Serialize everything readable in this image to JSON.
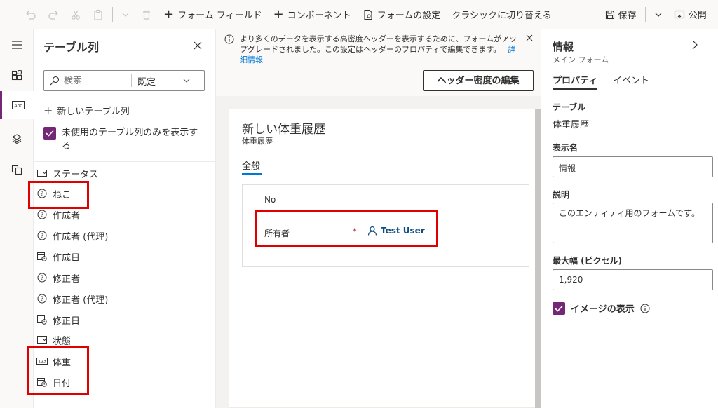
{
  "toolbar": {
    "undo_icon": "undo-icon",
    "redo_icon": "redo-icon",
    "cut_icon": "cut-icon",
    "paste_icon": "paste-icon",
    "delete_icon": "delete-icon",
    "form_field_label": "フォーム フィールド",
    "component_label": "コンポーネント",
    "form_settings_label": "フォームの設定",
    "classic_label": "クラシックに切り替える",
    "save_label": "保存",
    "publish_label": "公開"
  },
  "leftnav": {
    "items": [
      "hamburger-icon",
      "components-icon",
      "table-columns-icon",
      "layers-icon",
      "form-libraries-icon"
    ]
  },
  "field_pane": {
    "title": "テーブル列",
    "search_placeholder": "検索",
    "filter_value": "既定",
    "new_column_label": "新しいテーブル列",
    "show_unused_label": "未使用のテーブル列のみを表示する",
    "fields": [
      {
        "label": "ステータス",
        "icon": "option-set-icon"
      },
      {
        "label": "ねこ",
        "icon": "unknown-type-icon"
      },
      {
        "label": "作成者",
        "icon": "unknown-type-icon"
      },
      {
        "label": "作成者 (代理)",
        "icon": "unknown-type-icon"
      },
      {
        "label": "作成日",
        "icon": "date-time-icon"
      },
      {
        "label": "修正者",
        "icon": "unknown-type-icon"
      },
      {
        "label": "修正者 (代理)",
        "icon": "unknown-type-icon"
      },
      {
        "label": "修正日",
        "icon": "date-time-icon"
      },
      {
        "label": "状態",
        "icon": "option-set-icon"
      },
      {
        "label": "体重",
        "icon": "number-icon"
      },
      {
        "label": "日付",
        "icon": "date-time-icon"
      }
    ]
  },
  "canvas": {
    "notice_text": "より多くのデータを表示する高密度ヘッダーを表示するために、フォームがアップグレードされました。この設定はヘッダーのプロパティで編集できます。",
    "notice_link": "詳細情報",
    "header_density_button": "ヘッダー密度の編集",
    "form_title": "新しい体重履歴",
    "form_subtitle": "体重履歴",
    "tab_label": "全般",
    "rows": [
      {
        "label": "No",
        "value": "---"
      },
      {
        "label": "所有者",
        "required_mark": "*",
        "value": "Test User"
      }
    ]
  },
  "properties": {
    "title": "情報",
    "subtitle": "メイン フォーム",
    "tab_properties": "プロパティ",
    "tab_events": "イベント",
    "table_label": "テーブル",
    "table_value": "体重履歴",
    "display_name_label": "表示名",
    "display_name_value": "情報",
    "description_label": "説明",
    "description_value": "このエンティティ用のフォームです。",
    "max_width_label": "最大幅 (ピクセル)",
    "max_width_value": "1,920",
    "show_image_label": "イメージの表示"
  },
  "colors": {
    "accent": "#742774",
    "link": "#0078d4",
    "highlight": "#e00000"
  }
}
